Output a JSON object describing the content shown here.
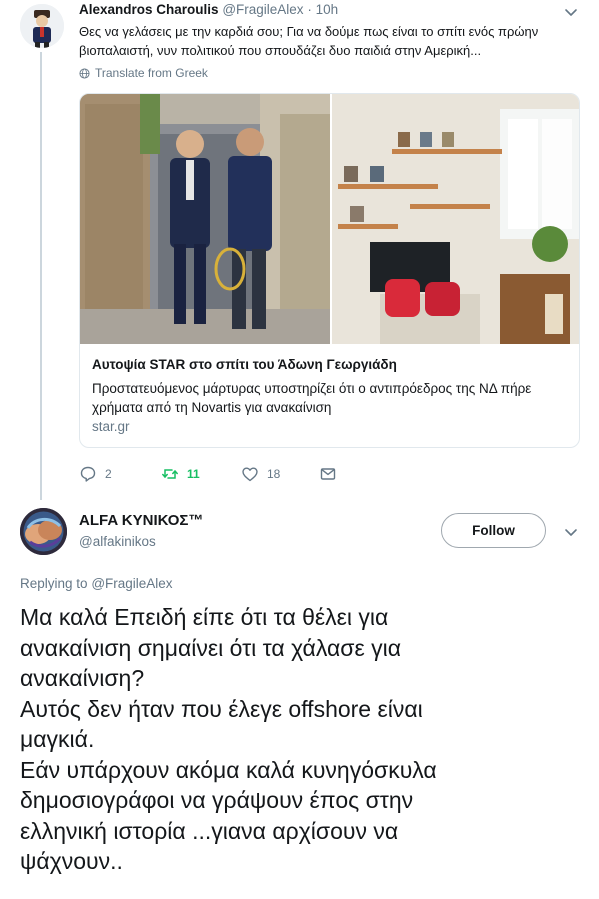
{
  "parent_tweet": {
    "author_name": "Alexandros Charoulis",
    "author_handle": "@FragileAlex",
    "time": "10h",
    "separator": "·",
    "text": "Θες να γελάσεις με την καρδιά σου; Για να δούμε πως είναι το σπίτι ενός πρώην βιοπαλαιστή, νυν πολιτικού που σπουδάζει δυο παιδιά στην Αμερική...",
    "translate_label": "Translate from Greek",
    "card": {
      "title": "Αυτοψία STAR στο σπίτι του Άδωνη Γεωργιάδη",
      "description": "Προστατευόμενος μάρτυρας υποστηρίζει ότι ο αντιπρόεδρος της ΝΔ πήρε χρήματα από τη Novartis για ανακαίνιση",
      "domain": "star.gr"
    },
    "actions": {
      "reply_count": "2",
      "retweet_count": "11",
      "like_count": "18"
    }
  },
  "main_tweet": {
    "author_name": "ALFA ΚΥΝΙΚΟΣ™",
    "author_handle": "@alfakinikos",
    "follow_label": "Follow",
    "replying_prefix": "Replying to",
    "replying_to": "@FragileAlex",
    "text_lines": [
      "Μα καλά Επειδή είπε ότι τα θέλει για",
      "ανακαίνιση σημαίνει ότι τα χάλασε για",
      "ανακαίνιση?",
      "Αυτός δεν ήταν που έλεγε offshore είναι",
      "μαγκιά.",
      "Εάν υπάρχουν ακόμα καλά κυνηγόσκυλα",
      "δημοσιογράφοι να γράψουν έπος στην",
      "ελληνική ιστορία ...γιανα αρχίσουν να",
      "ψάχνουν.."
    ]
  },
  "colors": {
    "text_primary": "#14171a",
    "text_secondary": "#657786",
    "retweet_green": "#17bf63",
    "border": "#e1e8ed"
  },
  "icons": [
    "globe-icon",
    "reply-icon",
    "retweet-icon",
    "like-icon",
    "message-icon",
    "chevron-down-icon"
  ]
}
